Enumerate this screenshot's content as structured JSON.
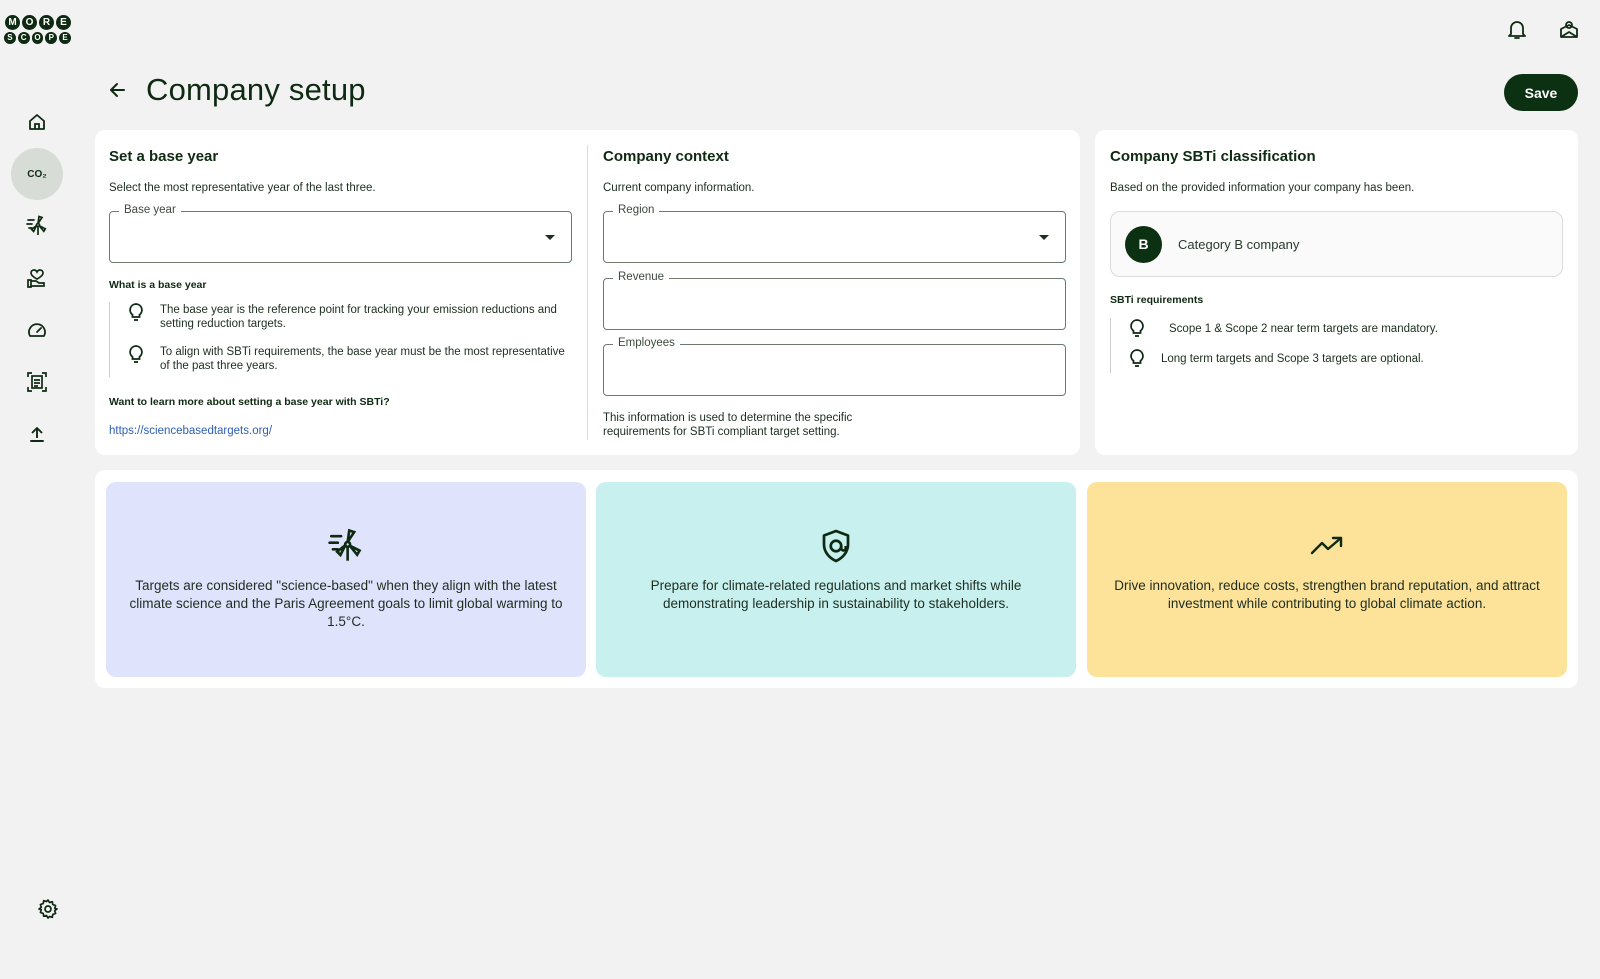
{
  "brand": {
    "logo_row1": [
      "M",
      "O",
      "R",
      "E"
    ],
    "logo_row2": [
      "S",
      "C",
      "O",
      "P",
      "E"
    ]
  },
  "topbar": {
    "icons": [
      "bell-icon",
      "profile-icon"
    ]
  },
  "sidebar": {
    "items": [
      {
        "icon": "home-icon",
        "active": false
      },
      {
        "icon": "co2-icon",
        "label": "CO₂",
        "active": true
      },
      {
        "icon": "wind-turbine-icon",
        "active": false
      },
      {
        "icon": "hand-heart-icon",
        "active": false
      },
      {
        "icon": "speedometer-icon",
        "active": false
      },
      {
        "icon": "report-icon",
        "active": false
      },
      {
        "icon": "upload-icon",
        "active": false
      }
    ],
    "settings_icon": "gear-icon"
  },
  "header": {
    "title": "Company setup",
    "save_label": "Save"
  },
  "base_year": {
    "title": "Set a base year",
    "subtitle": "Select the most representative year of the last three.",
    "field_label": "Base year",
    "field_value": "",
    "what_is_title": "What is a base year",
    "tips": [
      "The base year is the reference point for tracking your emission reductions and setting reduction targets.",
      "To align with SBTi requirements, the base year must be the most representative of the past three years."
    ],
    "learn_more": "Want to learn more about setting a base year with SBTi?",
    "link": "https://sciencebasedtargets.org/"
  },
  "company_context": {
    "title": "Company context",
    "subtitle": "Current company information.",
    "region_label": "Region",
    "region_value": "",
    "revenue_label": "Revenue",
    "revenue_value": "",
    "employees_label": "Employees",
    "employees_value": "",
    "info": "This information is used to determine the specific requirements for SBTi compliant target setting."
  },
  "classification": {
    "title": "Company SBTi classification",
    "subtitle": "Based on the provided information your company has been.",
    "avatar": "B",
    "category": "Category B company",
    "requirements_title": "SBTi requirements",
    "requirements": [
      "Scope 1 & Scope 2 near term targets are mandatory.",
      "Long term targets and Scope 3 targets are optional."
    ]
  },
  "info_cards": [
    {
      "icon": "wind-turbine-icon",
      "color": "#dfe3fb",
      "text": "Targets are considered \"science-based\" when they align with the latest climate science and the Paris Agreement goals to limit global warming to 1.5°C."
    },
    {
      "icon": "shield-icon",
      "color": "#c8f0ef",
      "text": "Prepare for climate-related regulations and market shifts while demonstrating leadership in sustainability to stakeholders."
    },
    {
      "icon": "trending-up-icon",
      "color": "#fde29a",
      "text": "Drive innovation, reduce costs, strengthen brand reputation, and attract investment while contributing to global climate action."
    }
  ],
  "colors": {
    "primary": "#0c3012",
    "background": "#f2f2f2",
    "link": "#2d5fb6"
  }
}
